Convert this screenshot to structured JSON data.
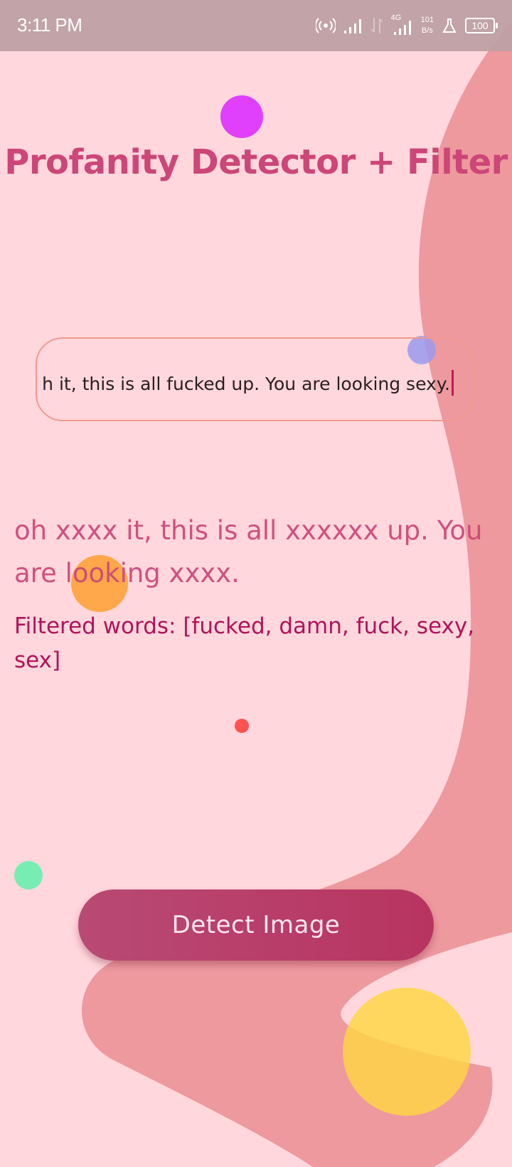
{
  "status_bar": {
    "time": "3:11 PM",
    "network_type": "4G",
    "net_speed_value": "101",
    "net_speed_unit": "B/s",
    "battery": "100"
  },
  "app": {
    "title": "Profanity Detector + Filter"
  },
  "input": {
    "value": "h it, this is all fucked up. You are looking sexy."
  },
  "output": {
    "censored_text": "oh xxxx it, this is all xxxxxx up. You are looking xxxx.",
    "filtered_words": "Filtered words: [fucked, damn, fuck, sexy, sex]"
  },
  "actions": {
    "detect_label": "Detect Image"
  },
  "colors": {
    "background": "#ffd7dc",
    "wave": "#e88a8f",
    "accent": "#cc4678",
    "button": "#b83d68"
  },
  "icons": {
    "hotspot": "hotspot-icon",
    "signal": "signal-icon",
    "data": "data-transfer-icon",
    "flask": "flask-icon",
    "battery": "battery-icon"
  }
}
